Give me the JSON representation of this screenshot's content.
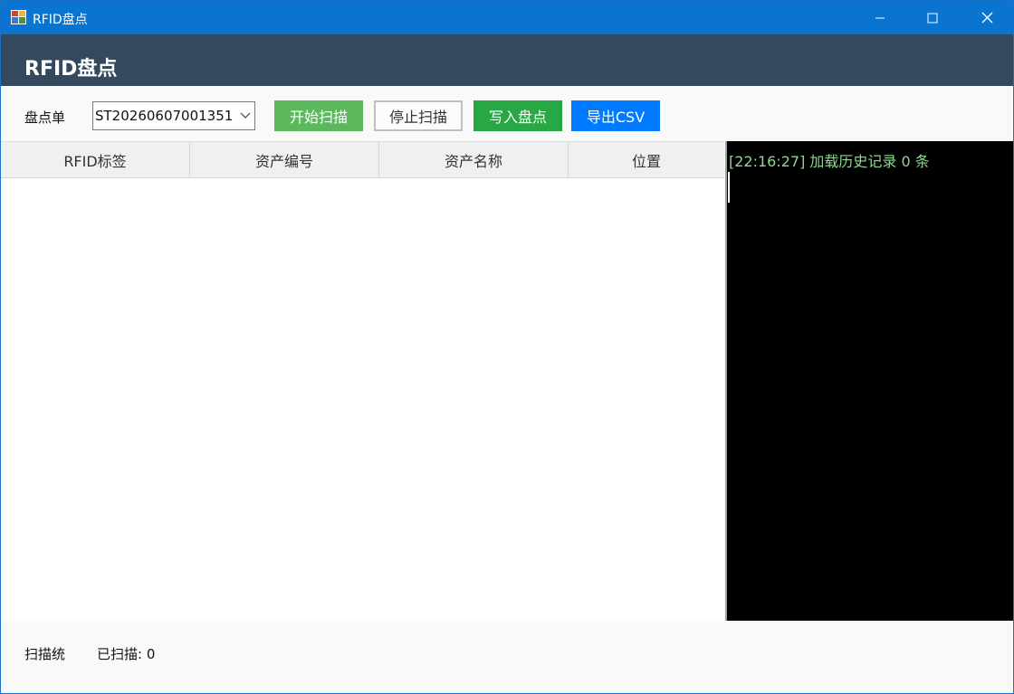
{
  "window": {
    "title": "RFID盘点",
    "colors": {
      "titlebar": "#0a74d0",
      "header": "#34495e"
    }
  },
  "header": {
    "title": "RFID盘点"
  },
  "toolbar": {
    "order_label": "盘点单",
    "order_select_value": "ST20260607001351",
    "start_scan_label": "开始扫描",
    "stop_scan_label": "停止扫描",
    "write_inventory_label": "写入盘点",
    "export_csv_label": "导出CSV",
    "colors": {
      "start": "#5cb85c",
      "write": "#28a745",
      "export": "#007bff"
    }
  },
  "table": {
    "columns": [
      "RFID标签",
      "资产编号",
      "资产名称",
      "位置"
    ],
    "rows": []
  },
  "log": {
    "lines": [
      "[22:16:27] 加载历史记录 0 条"
    ],
    "text_color": "#8fd68f"
  },
  "status": {
    "label": "扫描统",
    "scanned_text": "已扫描: 0"
  },
  "icons": [
    "app-icon",
    "minimize-icon",
    "maximize-icon",
    "close-icon",
    "chevron-down-icon"
  ]
}
